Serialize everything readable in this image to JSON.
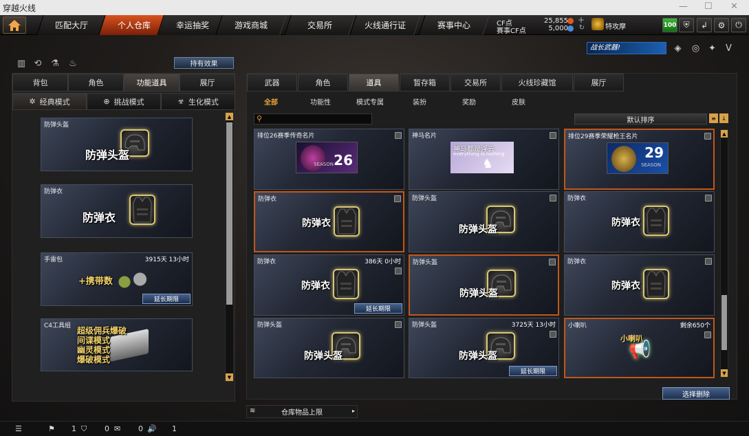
{
  "window": {
    "title": "穿越火线"
  },
  "topnav": {
    "tabs": [
      "匹配大厅",
      "个人仓库",
      "幸运抽奖",
      "游戏商城",
      "交易所",
      "火线通行证",
      "赛事中心"
    ],
    "active": "个人仓库"
  },
  "currency": {
    "cf_label": "CF点",
    "cf_value": "25,855",
    "match_label": "赛事CF点",
    "match_value": "5,000"
  },
  "user": {
    "name": "特攻摩",
    "badge_value": "100"
  },
  "banner": {
    "text": "战长武器!"
  },
  "left": {
    "effect_button": "持有效果",
    "tabs": [
      "背包",
      "角色",
      "功能道具",
      "展厅"
    ],
    "active_tab": "功能道具",
    "modes": [
      "经典模式",
      "挑战模式",
      "生化模式"
    ],
    "active_mode": "经典模式",
    "items": [
      {
        "name": "防弹头盔",
        "label": "防弹头盔",
        "time": "",
        "extend": ""
      },
      {
        "name": "防弹衣",
        "label": "防弹衣",
        "time": "",
        "extend": ""
      },
      {
        "name": "手雷包",
        "label": "+携带数",
        "time": "3915天 13小时",
        "extend": "延长期限"
      },
      {
        "name": "C4工具组",
        "label": "超级佣兵爆破\n间谍模式\n幽灵模式\n爆破模式",
        "time": "",
        "extend": ""
      }
    ]
  },
  "right": {
    "tabs": [
      "武器",
      "角色",
      "道具",
      "暂存箱",
      "交易所",
      "火线珍藏馆",
      "展厅"
    ],
    "active_tab": "道具",
    "filters": [
      "全部",
      "功能性",
      "模式专属",
      "装扮",
      "奖励",
      "皮肤"
    ],
    "active_filter": "全部",
    "search_placeholder": "",
    "sort_label": "默认排序",
    "items": [
      {
        "name": "排位26赛季传奇名片",
        "label": "",
        "time": "",
        "extend": "",
        "kind": "card26",
        "selected": false,
        "card_text": "26",
        "card_sub": "SEASON"
      },
      {
        "name": "神马名片",
        "label": "",
        "time": "",
        "extend": "",
        "kind": "horse",
        "selected": false,
        "card_text": "神马都是浮云",
        "card_sub": "everything is nothing"
      },
      {
        "name": "排位29赛季荣耀枪王名片",
        "label": "",
        "time": "",
        "extend": "",
        "kind": "card29",
        "selected": true,
        "card_text": "29",
        "card_sub": "SEASON"
      },
      {
        "name": "防弹衣",
        "label": "防弹衣",
        "time": "",
        "extend": "",
        "kind": "vest",
        "selected": true
      },
      {
        "name": "防弹头盔",
        "label": "防弹头盔",
        "time": "",
        "extend": "",
        "kind": "helmet",
        "selected": false
      },
      {
        "name": "防弹衣",
        "label": "防弹衣",
        "time": "",
        "extend": "",
        "kind": "vest",
        "selected": false
      },
      {
        "name": "防弹衣",
        "label": "防弹衣",
        "time": "386天 0小时",
        "extend": "延长期限",
        "kind": "vest",
        "selected": false
      },
      {
        "name": "防弹头盔",
        "label": "防弹头盔",
        "time": "",
        "extend": "",
        "kind": "helmet",
        "selected": true
      },
      {
        "name": "防弹衣",
        "label": "防弹衣",
        "time": "",
        "extend": "",
        "kind": "vest",
        "selected": false
      },
      {
        "name": "防弹头盔",
        "label": "防弹头盔",
        "time": "",
        "extend": "",
        "kind": "helmet",
        "selected": false
      },
      {
        "name": "防弹头盔",
        "label": "防弹头盔",
        "time": "3725天 13小时",
        "extend": "延长期限",
        "kind": "helmet",
        "selected": false
      },
      {
        "name": "小喇叭",
        "label": "小喇叭",
        "time": "剩余650个",
        "extend": "",
        "kind": "speaker",
        "selected": true
      }
    ],
    "delete_button": "选择删除",
    "limit_label": "仓库物品上限"
  },
  "bottombar": {
    "values": [
      "1",
      "0",
      "0",
      "1"
    ]
  },
  "colors": {
    "accent": "#d8531f",
    "selected_border": "#c0581d",
    "button_blue": "#1d2f4e",
    "scroll_arrow": "#d8a24a"
  }
}
